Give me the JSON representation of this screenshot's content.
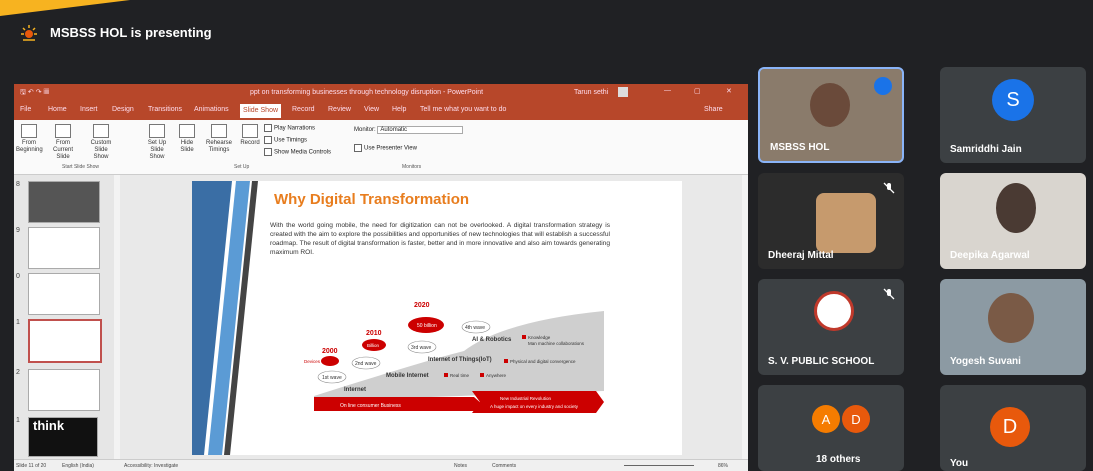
{
  "meeting": {
    "presenting_text": "MSBSS HOL is presenting",
    "accent_color": "#f7b320"
  },
  "ppt": {
    "window_title": "ppt on transforming businesses through technology disruption - PowerPoint",
    "user_name": "Tarun sethi",
    "menu": [
      "File",
      "Home",
      "Insert",
      "Design",
      "Transitions",
      "Animations",
      "Slide Show",
      "Record",
      "Review",
      "View",
      "Help",
      "Tell me what you want to do"
    ],
    "share_label": "Share",
    "ribbon": {
      "from_beginning": "From Beginning",
      "from_current": "From Current Slide",
      "custom_show": "Custom Slide Show",
      "setup_show": "Set Up Slide Show",
      "hide_slide": "Hide Slide",
      "rehearse": "Rehearse Timings",
      "record": "Record",
      "play_narrations": "Play Narrations",
      "use_timings": "Use Timings",
      "show_media": "Show Media Controls",
      "monitor_label": "Monitor:",
      "monitor_value": "Automatic",
      "presenter_view": "Use Presenter View",
      "group_start": "Start Slide Show",
      "group_setup": "Set Up",
      "group_monitors": "Monitors"
    },
    "thumbnails": [
      {
        "num": "8"
      },
      {
        "num": "9"
      },
      {
        "num": "0"
      },
      {
        "num": "1"
      },
      {
        "num": "2"
      },
      {
        "num": "1",
        "label": "think"
      }
    ],
    "slide": {
      "title": "Why Digital Transformation",
      "body": "With the world going mobile, the need for digitization can not be overlooked. A digital transformation strategy is created with the aim to explore the possibilities and opportunities of new technologies that will establish a successful roadmap. The result of digital transformation is faster, better and in more innovative and also aim towards generating maximum ROI.",
      "figure": {
        "years": [
          "2000",
          "2010",
          "2020"
        ],
        "bubbles": [
          "Devices",
          "Billion",
          "50 billion"
        ],
        "waves": [
          "1st wave",
          "2nd wave",
          "3rd wave",
          "4th wave"
        ],
        "stages": [
          "Internet",
          "Mobile Internet",
          "Internet of Things(IoT)",
          "AI & Robotics"
        ],
        "legend": [
          "Knowledge",
          "Man machine collaborations",
          "Physical and digital convergence",
          "Real time",
          "Anywhere"
        ],
        "bottom_left": "On line consumer Business",
        "bottom_right_1": "New Industrial Revolution",
        "bottom_right_2": "A huge impact on every industry and society"
      }
    },
    "status": {
      "slide_of": "Slide 11 of 20",
      "language": "English (India)",
      "accessibility": "Accessibility: Investigate",
      "notes": "Notes",
      "comments": "Comments",
      "zoom": "86%"
    }
  },
  "participants": [
    {
      "name": "MSBSS HOL",
      "type": "video"
    },
    {
      "name": "Samriddhi Jain",
      "type": "avatar",
      "initial": "S",
      "color": "#1a73e8"
    },
    {
      "name": "Dheeraj Mittal",
      "type": "video"
    },
    {
      "name": "Deepika Agarwal",
      "type": "video"
    },
    {
      "name": "S. V. PUBLIC SCHOOL",
      "type": "logo"
    },
    {
      "name": "Yogesh Suvani",
      "type": "video"
    },
    {
      "name": "18 others",
      "type": "group",
      "initials": [
        "A",
        "D"
      ],
      "colors": [
        "#f57c00",
        "#e8590c"
      ]
    },
    {
      "name": "You",
      "type": "avatar",
      "initial": "D",
      "color": "#e8590c"
    }
  ]
}
